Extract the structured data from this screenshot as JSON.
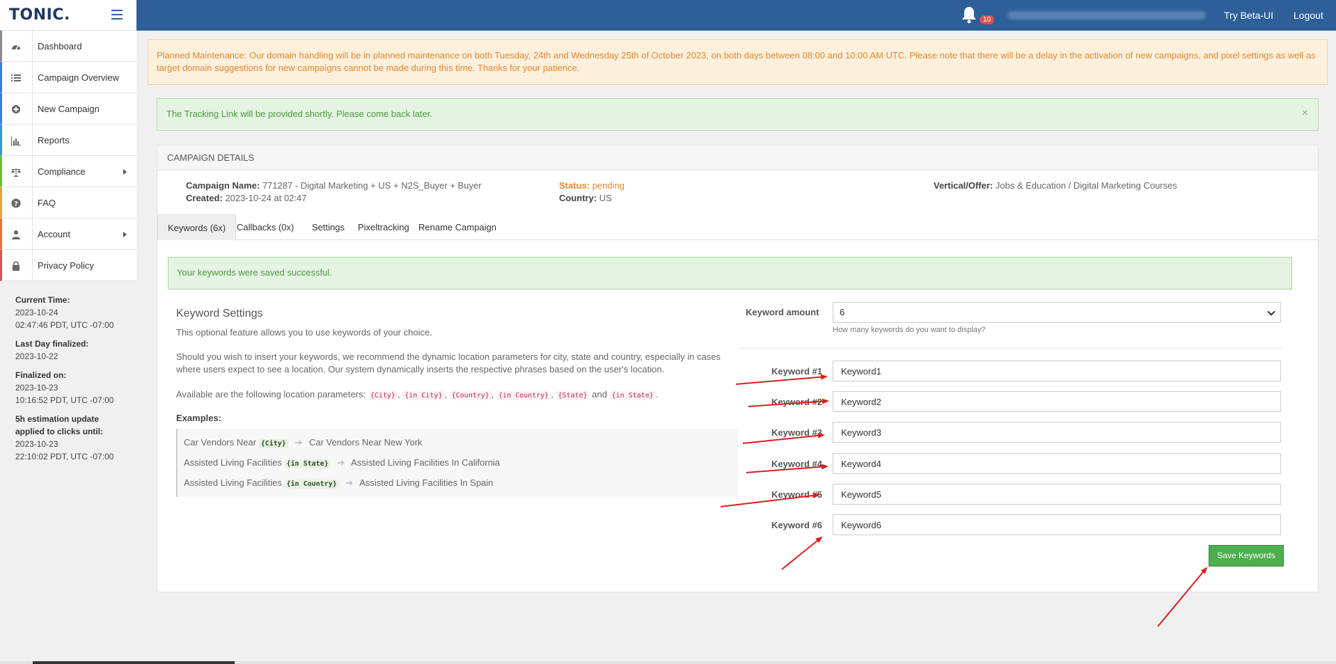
{
  "app": {
    "brand": "TONIC.",
    "notification_count": "10",
    "links": {
      "beta": "Try Beta-UI",
      "logout": "Logout"
    }
  },
  "sidebar": {
    "items": [
      {
        "label": "Dashboard",
        "icon": "dashboard-icon"
      },
      {
        "label": "Campaign Overview",
        "icon": "list-icon"
      },
      {
        "label": "New Campaign",
        "icon": "plus-circle-icon"
      },
      {
        "label": "Reports",
        "icon": "bar-chart-icon"
      },
      {
        "label": "Compliance",
        "icon": "scale-icon"
      },
      {
        "label": "FAQ",
        "icon": "question-icon"
      },
      {
        "label": "Account",
        "icon": "user-icon"
      },
      {
        "label": "Privacy Policy",
        "icon": "lock-icon"
      }
    ],
    "info": {
      "current_time_label": "Current Time:",
      "current_time_date": "2023-10-24",
      "current_time_value": "02:47:46 PDT, UTC -07:00",
      "last_day_label": "Last Day finalized:",
      "last_day_value": "2023-10-22",
      "finalized_label": "Finalized on:",
      "finalized_date": "2023-10-23",
      "finalized_time": "10:16:52 PDT, UTC -07:00",
      "estimation_label_1": "5h estimation update",
      "estimation_label_2": "applied to clicks until:",
      "estimation_date": "2023-10-23",
      "estimation_time": "22:10:02 PDT, UTC -07:00"
    }
  },
  "maintenance": {
    "text": "Planned Maintenance: Our domain handling will be in planned maintenance on both Tuesday, 24th and Wednesday 25th of October 2023, on both days between 08:00 and 10:00 AM UTC. Please note that there will be a delay in the activation of new campaigns, and pixel settings as well as target domain suggestions for new campaigns cannot be made during this time. Thanks for your patience."
  },
  "tracking_alert": {
    "text": "The Tracking Link will be provided shortly. Please come back later.",
    "close": "×"
  },
  "campaign": {
    "header": "CAMPAIGN DETAILS",
    "name_label": "Campaign Name:",
    "name_value": "771287 - Digital Marketing + US + N2S_Buyer + Buyer",
    "created_label": "Created:",
    "created_value": "2023-10-24 at 02:47",
    "status_label": "Status:",
    "status_value": "pending",
    "country_label": "Country:",
    "country_value": "US",
    "vertical_label": "Vertical/Offer:",
    "vertical_value": "Jobs & Education / Digital Marketing Courses"
  },
  "tabs": [
    {
      "label": "Keywords (6x)"
    },
    {
      "label": "Callbacks (0x)"
    },
    {
      "label": "Settings"
    },
    {
      "label": "Pixeltracking"
    },
    {
      "label": "Rename Campaign"
    }
  ],
  "saved_alert": {
    "text": "Your keywords were saved successful."
  },
  "keyword_settings": {
    "title": "Keyword Settings",
    "intro": "This optional feature allows you to use keywords of your choice.",
    "para": "Should you wish to insert your keywords, we recommend the dynamic location parameters for city, state and country, especially in cases where users expect to see a location. Our system dynamically inserts the respective phrases based on the user's location.",
    "params_prefix": "Available are the following location parameters:",
    "params": [
      "{City}",
      "{in City}",
      "{Country}",
      "{in Country}",
      "{State}",
      "{in State}"
    ],
    "params_and": "and",
    "examples_label": "Examples:",
    "examples": [
      {
        "prefix": "Car Vendors Near",
        "param": "{City}",
        "result": "Car Vendors Near New York"
      },
      {
        "prefix": "Assisted Living Facilities",
        "param": "{in State}",
        "result": "Assisted Living Facilities In California"
      },
      {
        "prefix": "Assisted Living Facilities",
        "param": "{in Country}",
        "result": "Assisted Living Facilities In Spain"
      }
    ]
  },
  "form": {
    "amount_label": "Keyword amount",
    "amount_value": "6",
    "amount_hint": "How many keywords do you want to display?",
    "keywords": [
      {
        "label": "Keyword #1",
        "value": "Keyword1"
      },
      {
        "label": "Keyword #2",
        "value": "Keyword2"
      },
      {
        "label": "Keyword #3",
        "value": "Keyword3"
      },
      {
        "label": "Keyword #4",
        "value": "Keyword4"
      },
      {
        "label": "Keyword #5",
        "value": "Keyword5"
      },
      {
        "label": "Keyword #6",
        "value": "Keyword6"
      }
    ],
    "save_label": "Save Keywords"
  },
  "colors": {
    "topbar": "#2e5f99",
    "annotation_arrow": "#e11b1b",
    "save_button": "#4cae4c",
    "pending": "#e8872b"
  }
}
